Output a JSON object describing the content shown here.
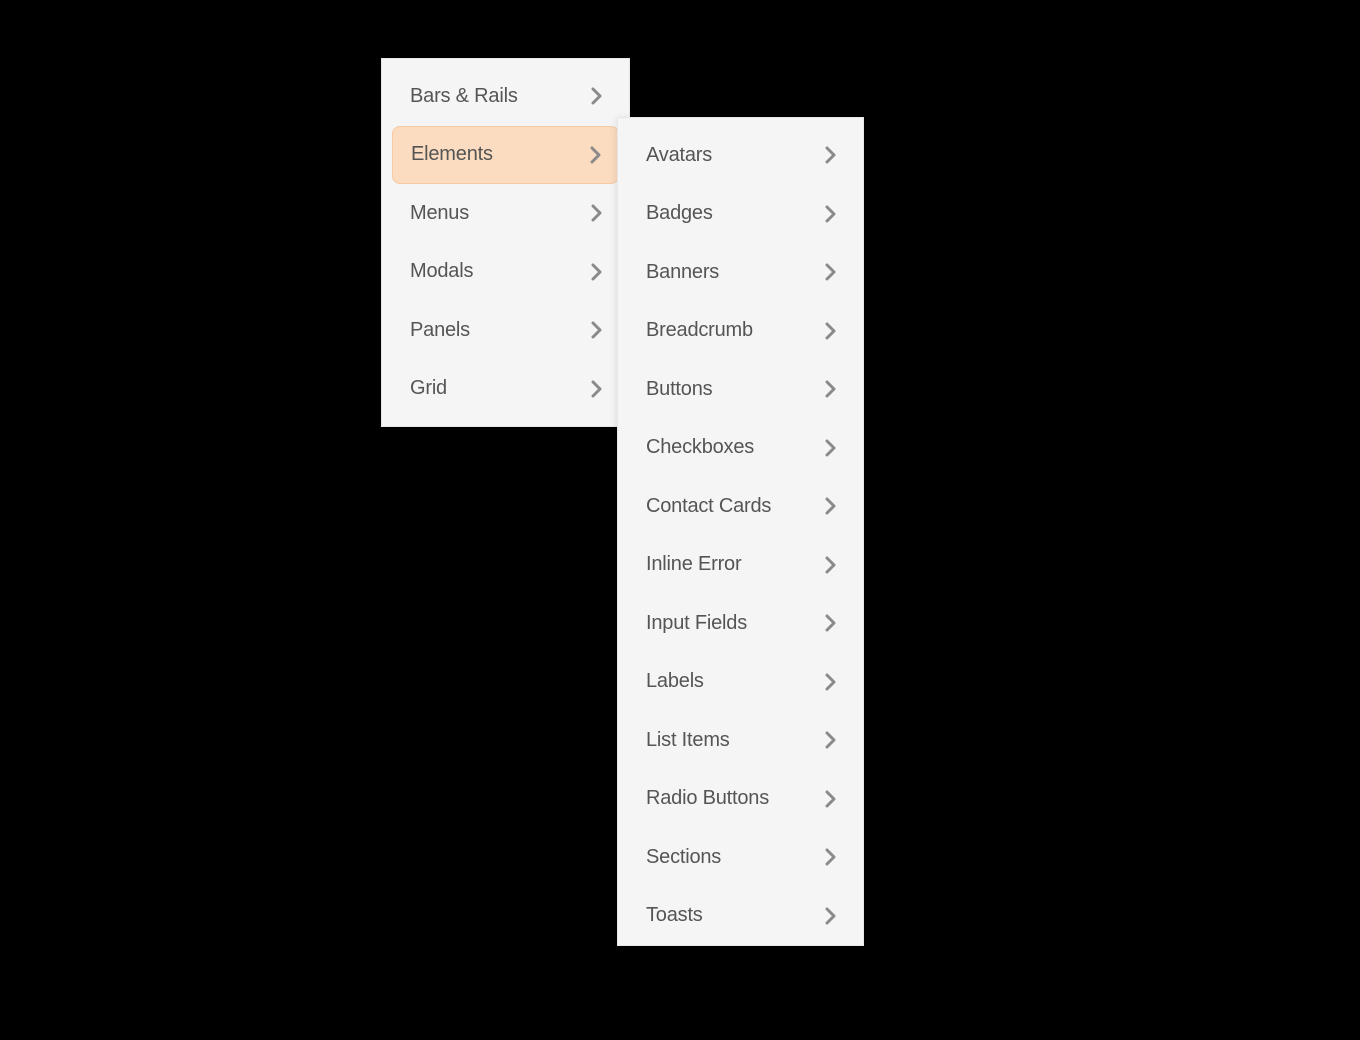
{
  "primaryMenu": {
    "items": [
      {
        "label": "Bars & Rails",
        "active": false
      },
      {
        "label": "Elements",
        "active": true
      },
      {
        "label": "Menus",
        "active": false
      },
      {
        "label": "Modals",
        "active": false
      },
      {
        "label": "Panels",
        "active": false
      },
      {
        "label": "Grid",
        "active": false
      }
    ]
  },
  "secondaryMenu": {
    "items": [
      {
        "label": "Avatars"
      },
      {
        "label": "Badges"
      },
      {
        "label": "Banners"
      },
      {
        "label": "Breadcrumb"
      },
      {
        "label": "Buttons"
      },
      {
        "label": "Checkboxes"
      },
      {
        "label": "Contact Cards"
      },
      {
        "label": "Inline Error"
      },
      {
        "label": "Input Fields"
      },
      {
        "label": "Labels"
      },
      {
        "label": "List Items"
      },
      {
        "label": "Radio Buttons"
      },
      {
        "label": "Sections"
      },
      {
        "label": "Toasts"
      }
    ]
  }
}
